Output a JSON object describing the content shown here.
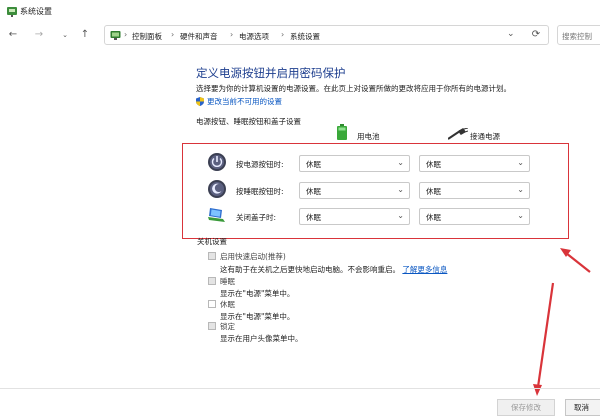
{
  "window": {
    "title": "系统设置"
  },
  "nav": {
    "breadcrumbs": [
      "控制面板",
      "硬件和声音",
      "电源选项",
      "系统设置"
    ],
    "search_placeholder": "搜索控制"
  },
  "content": {
    "title": "定义电源按钮并启用密码保护",
    "description": "选择要为你的计算机设置的电源设置。在此页上对设置所做的更改将应用于你所有的电源计划。",
    "change_link": "更改当前不可用的设置",
    "section_heading": "电源按钮、睡眠按钮和盖子设置",
    "columns": {
      "battery": "用电池",
      "plugged_in": "接通电源"
    },
    "rows": [
      {
        "label": "按电源按钮时:",
        "battery": "休眠",
        "plugged": "休眠"
      },
      {
        "label": "按睡眠按钮时:",
        "battery": "休眠",
        "plugged": "休眠"
      },
      {
        "label": "关闭盖子时:",
        "battery": "休眠",
        "plugged": "休眠"
      }
    ],
    "shutdown": {
      "heading": "关机设置",
      "options": [
        {
          "label": "启用快速启动(推荐)",
          "desc": "这有助于在关机之后更快地启动电脑。不会影响重启。",
          "link": "了解更多信息"
        },
        {
          "label": "睡眠",
          "desc": "显示在\"电源\"菜单中。"
        },
        {
          "label": "休眠",
          "desc": "显示在\"电源\"菜单中。"
        },
        {
          "label": "锁定",
          "desc": "显示在用户头像菜单中。"
        }
      ]
    }
  },
  "footer": {
    "save": "保存修改",
    "cancel": "取消"
  },
  "colors": {
    "annotation_red": "#d9343a",
    "link_blue": "#0a57c2",
    "title_blue": "#1e3f8f"
  }
}
